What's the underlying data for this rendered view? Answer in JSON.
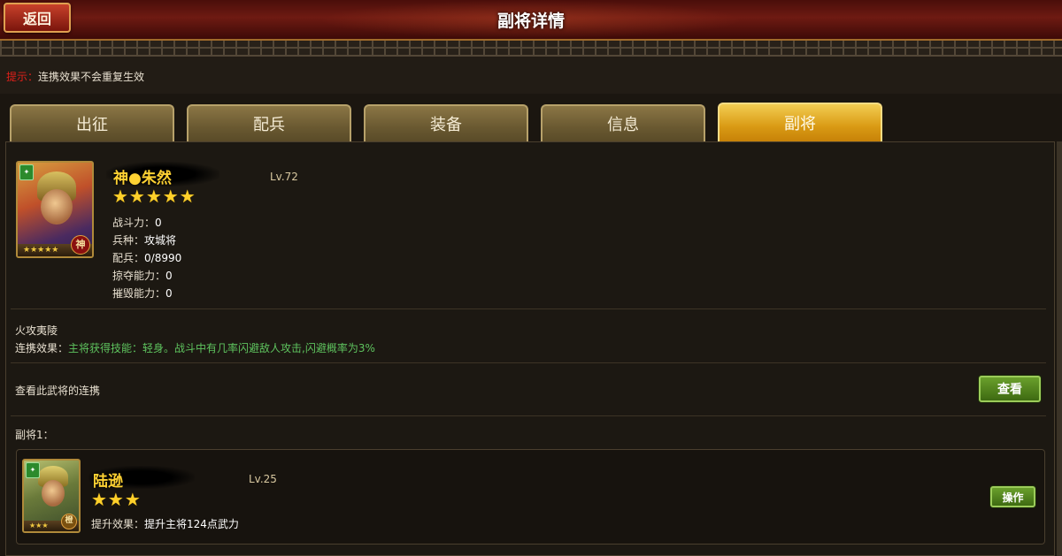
{
  "header": {
    "back_label": "返回",
    "title": "副将详情"
  },
  "hint": {
    "label": "提示：",
    "text": "连携效果不会重复生效"
  },
  "tabs": [
    {
      "label": "出征",
      "active": false
    },
    {
      "label": "配兵",
      "active": false
    },
    {
      "label": "装备",
      "active": false
    },
    {
      "label": "信息",
      "active": false
    },
    {
      "label": "副将",
      "active": true
    }
  ],
  "general": {
    "name": "神●朱然",
    "level": "Lv.72",
    "stars": "★★★★★",
    "portrait_stars": "★★★★★",
    "portrait_seal": "神",
    "stats": [
      {
        "key": "战斗力：",
        "value": "0"
      },
      {
        "key": "兵种：",
        "value": "攻城将"
      },
      {
        "key": "配兵：",
        "value": "0/8990"
      },
      {
        "key": "掠夺能力：",
        "value": "0"
      },
      {
        "key": "摧毁能力：",
        "value": "0"
      }
    ]
  },
  "link": {
    "skill_name": "火攻夷陵",
    "effect_label": "连携效果：",
    "effect_text": "主将获得技能：轻身。战斗中有几率闪避敌人攻击,闪避概率为3%",
    "view_text": "查看此武将的连携",
    "view_button": "查看"
  },
  "deputy": {
    "section_label": "副将1：",
    "name": "陆逊",
    "level": "Lv.25",
    "stars": "★★★",
    "portrait_stars": "★★★",
    "portrait_seal": "橙",
    "effect_label": "提升效果：",
    "effect_text": "提升主将124点武力",
    "action_button": "操作"
  },
  "colors": {
    "accent_gold": "#ffd233",
    "effect_green": "#5ec35e",
    "hint_red": "#e0201a",
    "tab_active": "#d99a14"
  }
}
